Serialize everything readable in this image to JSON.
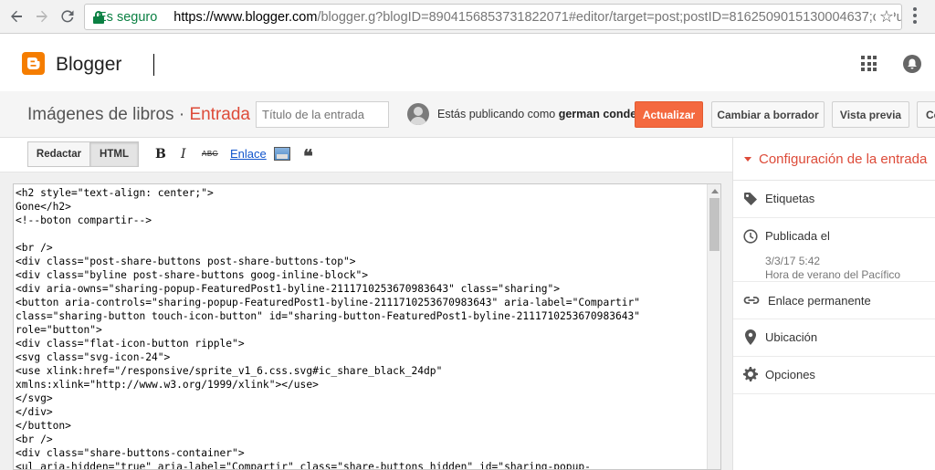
{
  "browser": {
    "secure_label": "Es seguro",
    "url_host": "https://www.blogger.com",
    "url_rest": "/blogger.g?blogID=8904156853731822071#editor/target=post;postID=8162509015130004637;onPublishedMenu=allposts;onClosedMenu=allposts;postNum=0;src=postname"
  },
  "header": {
    "app_title": "Blogger"
  },
  "post_bar": {
    "blog_name": "Imágenes de libros",
    "separator": " · ",
    "section": "Entrada",
    "title_placeholder": "Título de la entrada",
    "publishing_prefix": "Estás publicando como ",
    "user_name": "german conde",
    "update_label": "Actualizar",
    "draft_label": "Cambiar a borrador",
    "preview_label": "Vista previa",
    "close_label": "Cerrar"
  },
  "editor_toolbar": {
    "compose_label": "Redactar",
    "html_label": "HTML",
    "bold_label": "B",
    "italic_label": "I",
    "strike_label": "ABC",
    "link_label": "Enlace",
    "quote_label": "❝"
  },
  "code_lines": [
    "<h2 style=\"text-align: center;\">",
    "Gone</h2>",
    "<!--boton compartir-->",
    "",
    "<br />",
    "<div class=\"post-share-buttons post-share-buttons-top\">",
    "<div class=\"byline post-share-buttons goog-inline-block\">",
    "<div aria-owns=\"sharing-popup-FeaturedPost1-byline-2111710253670983643\" class=\"sharing\">",
    "<button aria-controls=\"sharing-popup-FeaturedPost1-byline-2111710253670983643\" aria-label=\"Compartir\"",
    "class=\"sharing-button touch-icon-button\" id=\"sharing-button-FeaturedPost1-byline-2111710253670983643\"",
    "role=\"button\">",
    "<div class=\"flat-icon-button ripple\">",
    "<svg class=\"svg-icon-24\">",
    "<use xlink:href=\"/responsive/sprite_v1_6.css.svg#ic_share_black_24dp\"",
    "xmlns:xlink=\"http://www.w3.org/1999/xlink\"></use>",
    "</svg>",
    "</div>",
    "</button>",
    "<br />",
    "<div class=\"share-buttons-container\">",
    "<ul aria-hidden=\"true\" aria-label=\"Compartir\" class=\"share-buttons hidden\" id=\"sharing-popup-"
  ],
  "sidebar": {
    "title": "Configuración de la entrada",
    "labels": "Etiquetas",
    "published_label": "Publicada el",
    "published_date": "3/3/17 5:42",
    "timezone": "Hora de verano del Pacífico",
    "permalink": "Enlace permanente",
    "location": "Ubicación",
    "options": "Opciones"
  }
}
